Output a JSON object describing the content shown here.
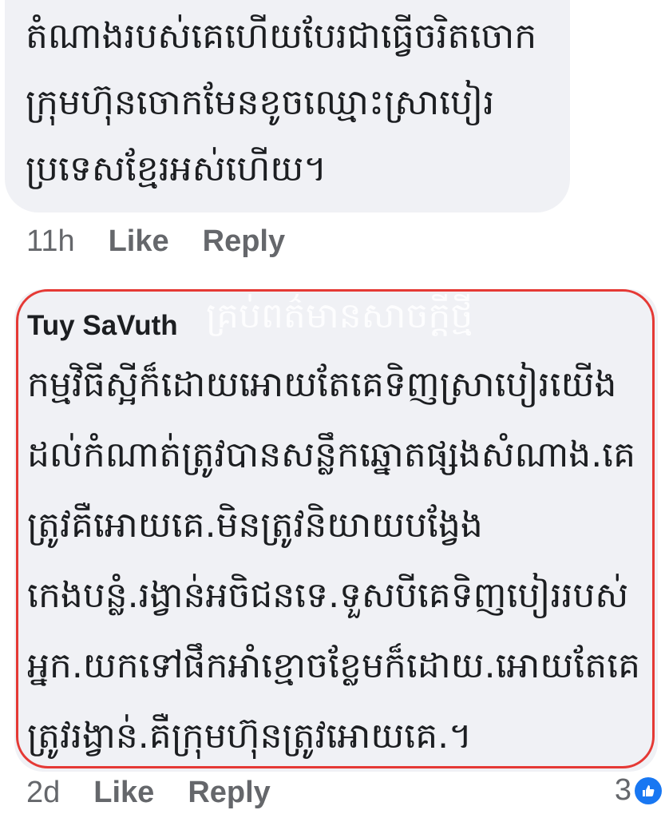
{
  "comments": [
    {
      "author": "",
      "lines": [
        "តំណាងរបស់គេហើយបែរជាធ្វើចរិតចោក",
        "ក្រុមហ៊ុនចោកមែនខូចឈ្មោះស្រាបៀរ",
        "ប្រទេសខ្មែរអស់ហើយ។"
      ],
      "time": "11h",
      "like_label": "Like",
      "reply_label": "Reply"
    },
    {
      "author": "Tuy SaVuth",
      "lines": [
        "កម្មវិធីស្អីក៏ដោយអោយតែគេទិញស្រាបៀរយើង",
        "ដល់កំណាត់ត្រូវបានសន្លឹកឆ្នោតផ្សងសំណាង.គេ",
        "ត្រូវគឺអោយគេ.មិនត្រូវនិយាយបង្វែង",
        "កេងបន្លំ.រង្វាន់អចិជនទេ.ទួសបីគេទិញបៀររបស់",
        "អ្នក.យកទៅផឹកអាំខ្មោចខ្លែមក៏ដោយ.អោយតែគេ",
        "ត្រូវរង្វាន់.គឺក្រុមហ៊ុនត្រូវអោយគេ.។"
      ],
      "time": "2d",
      "like_label": "Like",
      "reply_label": "Reply",
      "reaction_count": "3"
    }
  ],
  "watermark": "គ្រប់ពត៌មានសាចក្ដីថ្មី",
  "icons": {
    "reaction": "thumbs-up-icon"
  },
  "colors": {
    "bubble_bg": "#f0f1f5",
    "highlight_border": "#e53935",
    "meta_text": "#65676b",
    "like_badge": "#1877f2"
  }
}
